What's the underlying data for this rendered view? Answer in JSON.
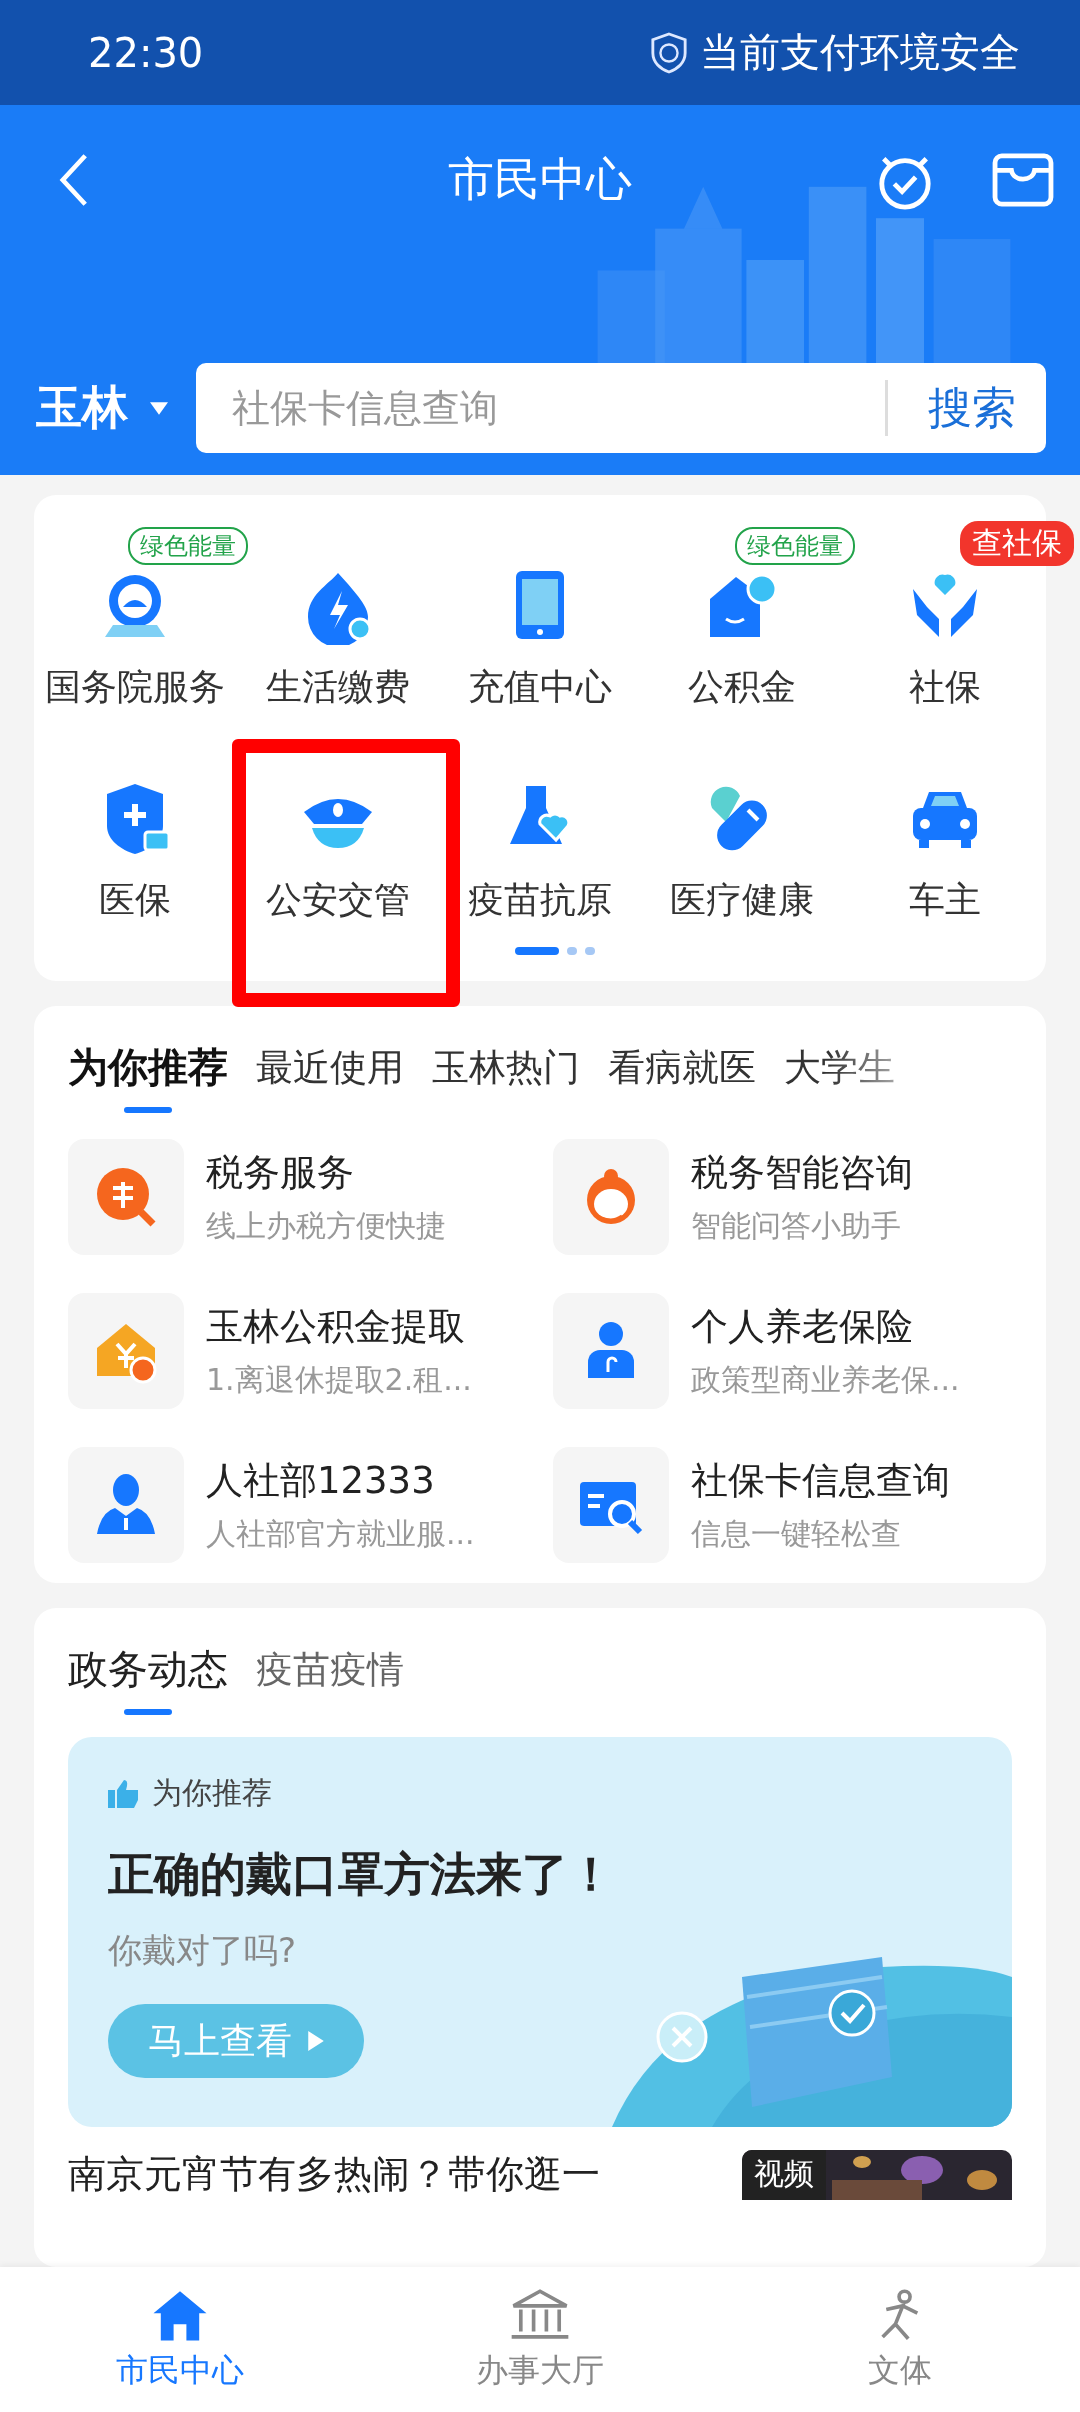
{
  "status_bar": {
    "time": "22:30",
    "security": "当前支付环境安全"
  },
  "header": {
    "title": "市民中心",
    "city": "玉林",
    "search": {
      "placeholder": "社保卡信息查询",
      "button": "搜索"
    }
  },
  "services": [
    {
      "label": "国务院服务",
      "badge": {
        "text": "绿色能量",
        "kind": "outline",
        "color": "#22a34a"
      },
      "highlighted": false
    },
    {
      "label": "生活缴费",
      "highlighted": false
    },
    {
      "label": "充值中心",
      "highlighted": false
    },
    {
      "label": "公积金",
      "badge": {
        "text": "绿色能量",
        "kind": "outline",
        "color": "#22a34a"
      },
      "highlighted": false
    },
    {
      "label": "社保",
      "badge": {
        "text": "查社保",
        "kind": "filled",
        "color": "#f2352c"
      },
      "highlighted": false
    },
    {
      "label": "医保",
      "highlighted": false
    },
    {
      "label": "公安交管",
      "highlighted": true
    },
    {
      "label": "疫苗抗原",
      "highlighted": false
    },
    {
      "label": "医疗健康",
      "highlighted": false
    },
    {
      "label": "车主",
      "highlighted": false
    }
  ],
  "pager": [
    {
      "selected": true
    },
    {
      "selected": false
    },
    {
      "selected": false
    }
  ],
  "recommend": {
    "tabs": [
      {
        "label": "为你推荐",
        "selected": true
      },
      {
        "label": "最近使用",
        "selected": false
      },
      {
        "label": "玉林热门",
        "selected": false
      },
      {
        "label": "看病就医",
        "selected": false
      },
      {
        "label": "大学生",
        "selected": false
      }
    ],
    "items": [
      {
        "title": "税务服务",
        "subtitle": "线上办税方便快捷"
      },
      {
        "title": "税务智能咨询",
        "subtitle": "智能问答小助手"
      },
      {
        "title": "玉林公积金提取",
        "subtitle": "1.离退休提取2.租..."
      },
      {
        "title": "个人养老保险",
        "subtitle": "政策型商业养老保..."
      },
      {
        "title": "人社部12333",
        "subtitle": "人社部官方就业服..."
      },
      {
        "title": "社保卡信息查询",
        "subtitle": "信息一键轻松查"
      }
    ]
  },
  "news": {
    "tabs": [
      {
        "label": "政务动态",
        "selected": true
      },
      {
        "label": "疫苗疫情",
        "selected": false
      }
    ],
    "banner": {
      "tag": "为你推荐",
      "title": "正确的戴口罩方法来了！",
      "subtitle": "你戴对了吗?",
      "button": "马上查看"
    },
    "headline": "南京元宵节有多热闹？带你逛一",
    "thumb_label": "视频"
  },
  "bottom_nav": [
    {
      "label": "市民中心",
      "selected": true
    },
    {
      "label": "办事大厅",
      "selected": false
    },
    {
      "label": "文体",
      "selected": false
    }
  ]
}
